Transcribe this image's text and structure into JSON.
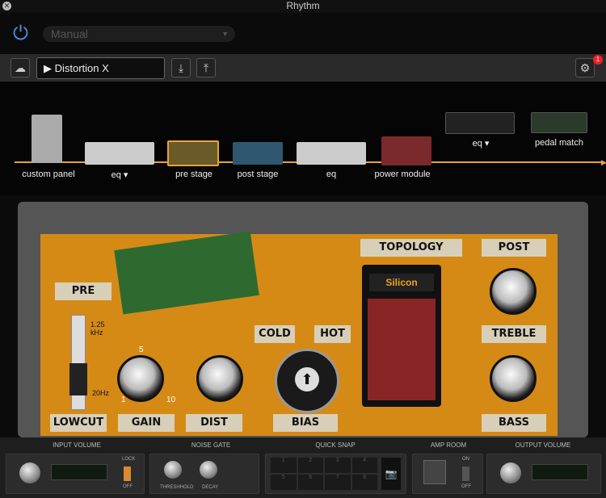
{
  "window": {
    "title": "Rhythm"
  },
  "header": {
    "preset_mode": "Manual",
    "preset_name": "Distortion X",
    "notification_count": "1"
  },
  "chain": {
    "items": [
      {
        "label": "custom panel"
      },
      {
        "label": "eq ▾"
      },
      {
        "label": "pre stage"
      },
      {
        "label": "post stage"
      },
      {
        "label": "eq"
      },
      {
        "label": "power module"
      },
      {
        "label": "eq ▾"
      },
      {
        "label": "pedal match"
      }
    ]
  },
  "pedal": {
    "pre": "PRE",
    "freq_high": "1.25 kHz",
    "freq_low": "20Hz",
    "lowcut": "LOWCUT",
    "gain": "GAIN",
    "dist": "DIST",
    "cold": "COLD",
    "hot": "HOT",
    "bias": "BIAS",
    "topology": "TOPOLOGY",
    "topology_value": "Silicon",
    "post": "POST",
    "treble": "TREBLE",
    "bass": "BASS",
    "scale_min": "1",
    "scale_mid": "5",
    "scale_max": "10"
  },
  "bottom": {
    "input_volume": "INPUT VOLUME",
    "noise_gate": "NOISE GATE",
    "quick_snap": "QUICK SNAP",
    "amp_room": "AMP ROOM",
    "output_volume": "OUTPUT VOLUME",
    "lock": "LOCK",
    "off": "OFF",
    "on": "ON",
    "threshold": "THRESHHOLD",
    "decay": "DECAY",
    "snaps": [
      "1",
      "2",
      "3",
      "4",
      "5",
      "6",
      "7",
      "8"
    ]
  },
  "colors": {
    "accent": "#e8a23a",
    "power": "#4a8fe0",
    "pcb": "#d58a16"
  }
}
